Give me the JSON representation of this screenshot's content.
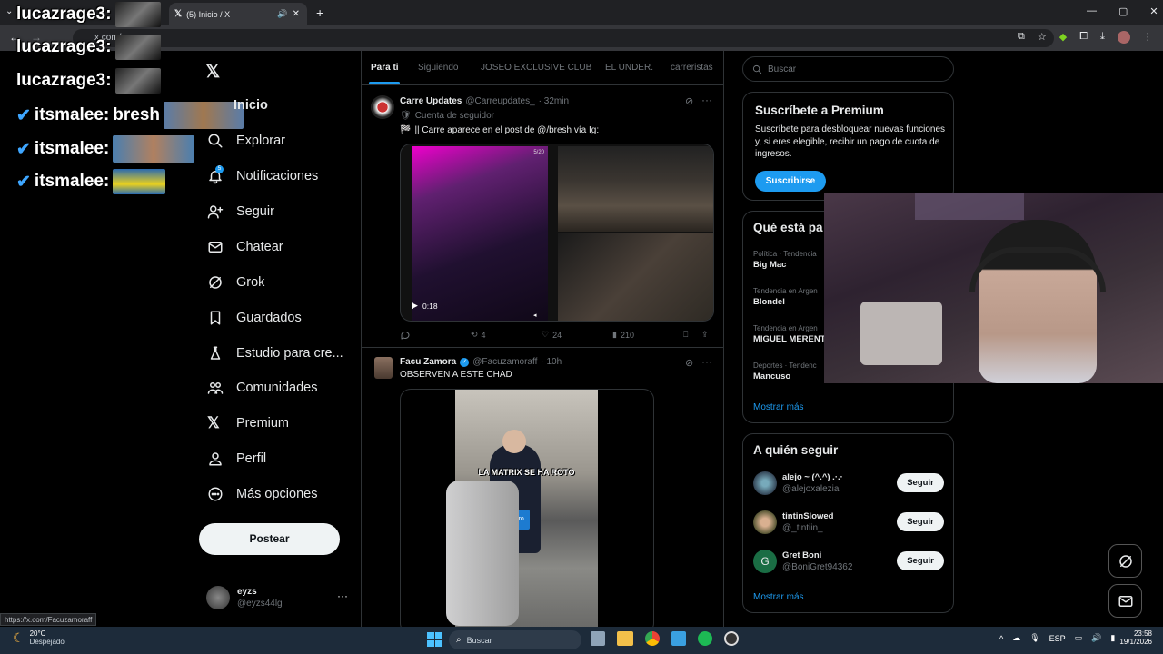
{
  "browser": {
    "tab_title": "(5) Inicio / X",
    "url": "x.com/",
    "status_url": "https://x.com/Facuzamoraff"
  },
  "chat": [
    {
      "user": "lucazrage3:",
      "msg": ""
    },
    {
      "user": "lucazrage3:",
      "msg": ""
    },
    {
      "user": "lucazrage3:",
      "msg": ""
    },
    {
      "user": "itsmalee:",
      "msg": "bresh"
    },
    {
      "user": "itsmalee:",
      "msg": ""
    },
    {
      "user": "itsmalee:",
      "msg": ""
    }
  ],
  "nav": {
    "items": [
      {
        "label": "Inicio",
        "icon": "home-icon"
      },
      {
        "label": "Explorar",
        "icon": "search-icon"
      },
      {
        "label": "Notificaciones",
        "icon": "bell-icon",
        "badge": "5"
      },
      {
        "label": "Seguir",
        "icon": "person-add-icon"
      },
      {
        "label": "Chatear",
        "icon": "mail-icon"
      },
      {
        "label": "Grok",
        "icon": "grok-icon"
      },
      {
        "label": "Guardados",
        "icon": "bookmark-icon"
      },
      {
        "label": "Estudio para cre...",
        "icon": "flask-icon"
      },
      {
        "label": "Comunidades",
        "icon": "people-icon"
      },
      {
        "label": "Premium",
        "icon": "x-logo-icon"
      },
      {
        "label": "Perfil",
        "icon": "person-icon"
      },
      {
        "label": "Más opciones",
        "icon": "more-circle-icon"
      }
    ],
    "post_label": "Postear",
    "account": {
      "name": "eyzs",
      "handle": "@eyzs44lg"
    }
  },
  "feed": {
    "tabs": [
      "Para ti",
      "Siguiendo",
      "JOSEO EXCLUSIVE CLUB",
      "EL UNDER.",
      "carreristas"
    ],
    "tweets": [
      {
        "name": "Carre Updates",
        "handle": "@Carreupdates_",
        "time": "· 32min",
        "context": "Cuenta de seguidor",
        "text": "|| Carre aparece en el post de @/bresh vía Ig:",
        "video_time": "0:18",
        "video_badge": "5/20",
        "replies": "",
        "retweets": "4",
        "likes": "24",
        "views": "210"
      },
      {
        "name": "Facu Zamora",
        "handle": "@Facuzamoraff",
        "time": "· 10h",
        "text": "OBSERVEN A ESTE CHAD",
        "caption": "LA MATRIX SE HA ROTO",
        "shirt_logo": "acro"
      }
    ]
  },
  "right": {
    "search_placeholder": "Buscar",
    "premium": {
      "title": "Suscríbete a Premium",
      "body": "Suscríbete para desbloquear nuevas funciones y, si eres elegible, recibir un pago de cuota de ingresos.",
      "button": "Suscribirse"
    },
    "trends": {
      "title": "Qué está pa",
      "items": [
        {
          "cat": "Política · Tendencia",
          "name": "Big Mac"
        },
        {
          "cat": "Tendencia en Argen",
          "name": "Blondel"
        },
        {
          "cat": "Tendencia en Argen",
          "name": "MIGUEL MERENT"
        },
        {
          "cat": "Deportes · Tendenc",
          "name": "Mancuso"
        }
      ],
      "more": "Mostrar más"
    },
    "follow": {
      "title": "A quién seguir",
      "items": [
        {
          "name": "alejo ~ (^.^) .·.·",
          "handle": "@alejoxalezia",
          "button": "Seguir"
        },
        {
          "name": "tintinSlowed",
          "handle": "@_tintiin_",
          "button": "Seguir"
        },
        {
          "name": "Gret Boni",
          "handle": "@BoniGret94362",
          "button": "Seguir",
          "initial": "G"
        }
      ],
      "more": "Mostrar más"
    }
  },
  "taskbar": {
    "temp": "20°C",
    "weather": "Despejado",
    "search": "Buscar",
    "lang": "ESP",
    "time": "23:58",
    "date": "19/1/2026"
  }
}
